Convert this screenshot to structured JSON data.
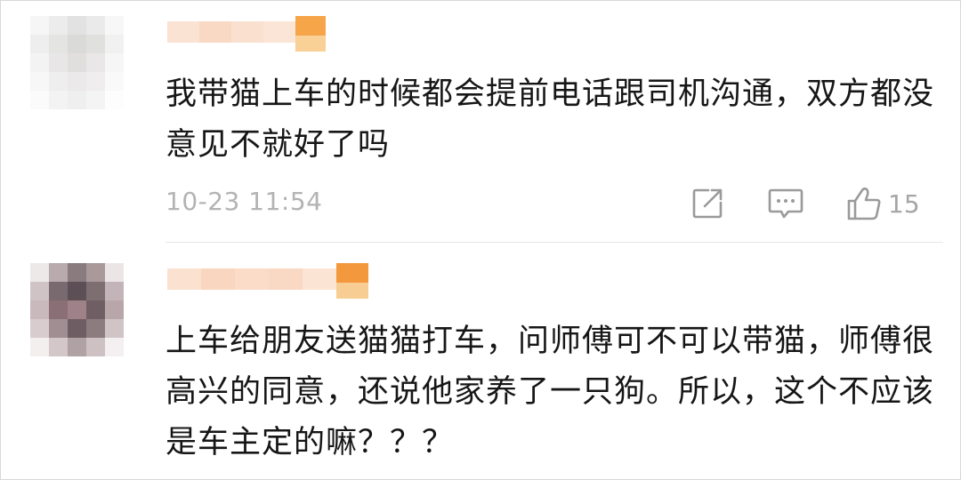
{
  "comments": [
    {
      "text": "我带猫上车的时候都会提前电话跟司机沟通，双方都没意见不就好了吗",
      "timestamp": "10-23 11:54",
      "like_count": "15"
    },
    {
      "text": "上车给朋友送猫猫打车，问师傅可不可以带猫，师傅很高兴的同意，还说他家养了一只狗。所以，这个不应该是车主定的嘛？？？"
    }
  ],
  "icons": {
    "share": "share-icon",
    "reply": "comment-icon",
    "like": "thumbs-up-icon"
  }
}
